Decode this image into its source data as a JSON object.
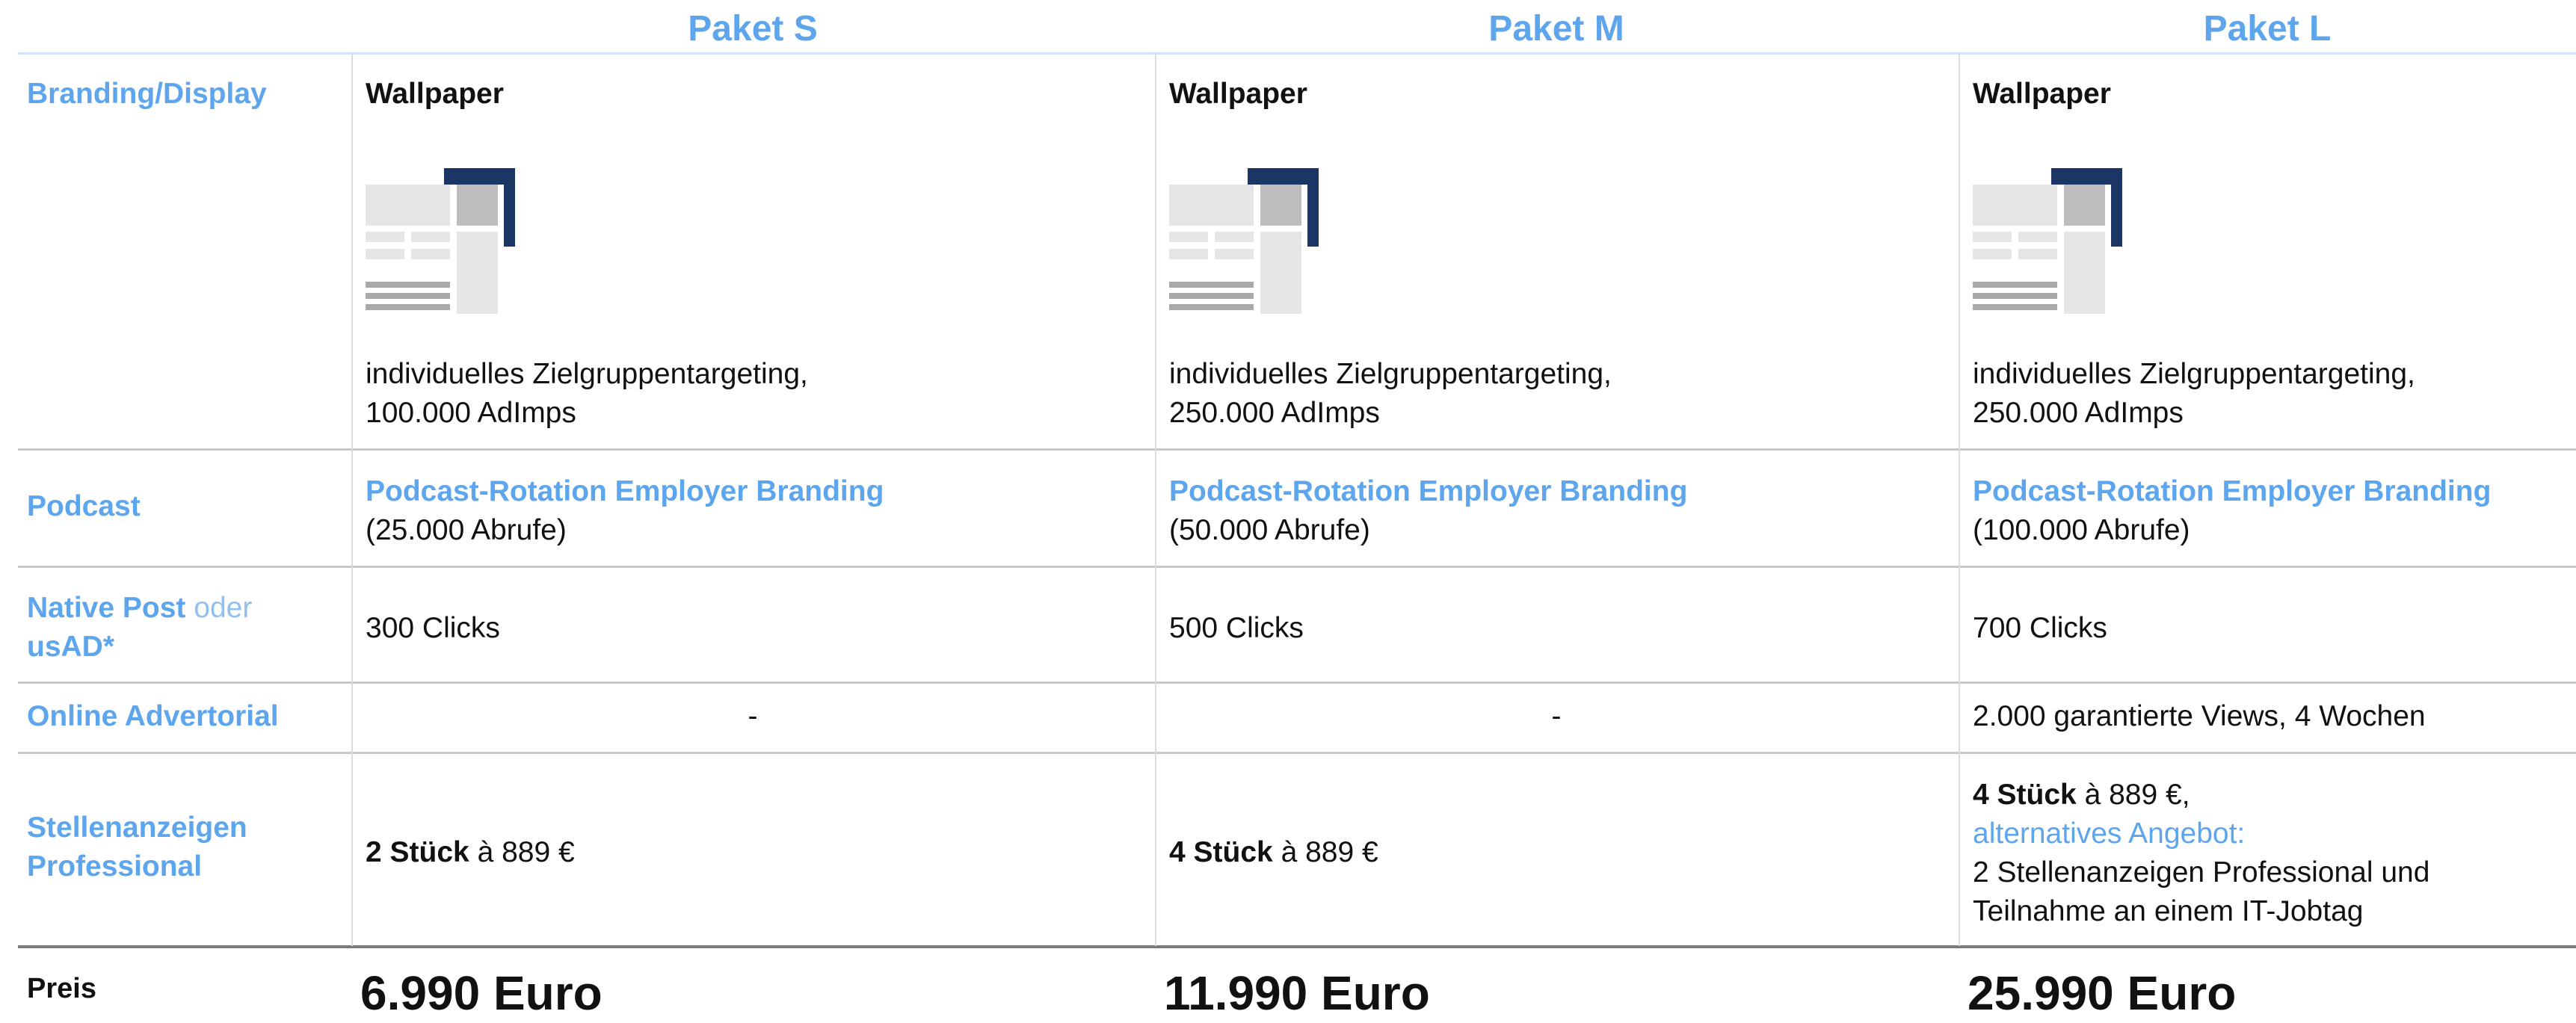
{
  "packages": [
    {
      "name": "Paket S"
    },
    {
      "name": "Paket M"
    },
    {
      "name": "Paket L"
    }
  ],
  "rows": {
    "branding": {
      "label": "Branding/Display"
    },
    "podcast": {
      "label": "Podcast"
    },
    "native": {
      "label_bold": "Native Post",
      "label_soft": "oder",
      "label_bold2": "usAD*"
    },
    "advertorial": {
      "label": "Online Advertorial"
    },
    "stellen": {
      "label_line1": "Stellenanzeigen",
      "label_line2": "Professional"
    },
    "preis": {
      "label": "Preis"
    }
  },
  "cols": [
    {
      "wallpaper_title": "Wallpaper",
      "wallpaper_icon": "wallpaper-ad-icon",
      "branding_line1": "individuelles Zielgruppentargeting,",
      "branding_line2": "100.000 AdImps",
      "podcast_title": "Podcast-Rotation Employer Branding",
      "podcast_sub": "(25.000 Abrufe)",
      "native": "300 Clicks",
      "advertorial": "-",
      "stellen_bold": "2 Stück",
      "stellen_rest": " à 889 €",
      "price": "6.990 Euro"
    },
    {
      "wallpaper_title": "Wallpaper",
      "wallpaper_icon": "wallpaper-ad-icon",
      "branding_line1": "individuelles Zielgruppentargeting,",
      "branding_line2": "250.000 AdImps",
      "podcast_title": "Podcast-Rotation Employer Branding",
      "podcast_sub": "(50.000 Abrufe)",
      "native": "500 Clicks",
      "advertorial": "-",
      "stellen_bold": "4 Stück",
      "stellen_rest": " à 889 €",
      "price": "11.990 Euro"
    },
    {
      "wallpaper_title": "Wallpaper",
      "wallpaper_icon": "wallpaper-ad-icon",
      "branding_line1": "individuelles Zielgruppentargeting,",
      "branding_line2": "250.000 AdImps",
      "podcast_title": "Podcast-Rotation Employer Branding",
      "podcast_sub": "(100.000 Abrufe)",
      "native": "700 Clicks",
      "advertorial": "2.000 garantierte Views, 4 Wochen",
      "stellen_bold": "4 Stück",
      "stellen_rest": " à 889 €,",
      "stellen_alt_label": "alternatives Angebot:",
      "stellen_alt_line1": "2 Stellenanzeigen Professional und",
      "stellen_alt_line2": "Teilnahme an einem IT-Jobtag",
      "price": "25.990 Euro"
    }
  ],
  "colors": {
    "accent": "#5da6ee",
    "accent_soft": "#8fc0f3",
    "icon_dark": "#1b3565",
    "icon_gray": "#bdbdbd",
    "icon_light": "#e6e6e6"
  }
}
